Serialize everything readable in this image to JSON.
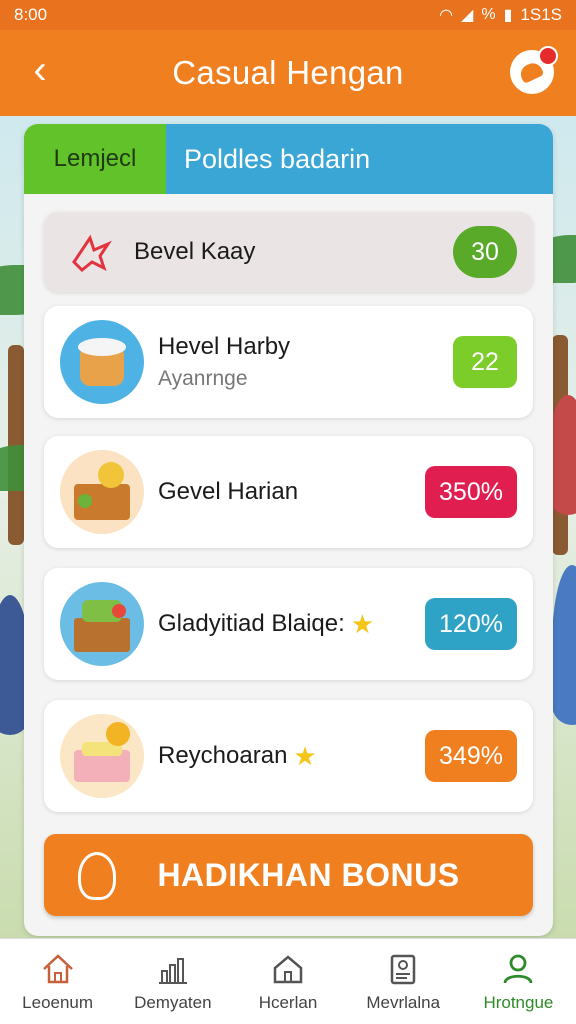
{
  "status_bar": {
    "time": "8:00",
    "battery_text": "1S1S",
    "percent_text": "%"
  },
  "app_bar": {
    "back_label": "‹",
    "title": "Casual Hengan"
  },
  "tabs": [
    {
      "label": "Lemjecl"
    },
    {
      "label": "Poldles badarin"
    }
  ],
  "rows": [
    {
      "name": "Bevel Kaay",
      "sub": "",
      "badge": "30",
      "badge_color": "#5aaa2a",
      "icon": "plane-icon"
    },
    {
      "name": "Hevel Harby",
      "sub": "Ayanrnge",
      "badge": "22",
      "badge_color": "#7ccc2a",
      "icon": "bucket-icon"
    },
    {
      "name": "Gevel Harian",
      "sub": "",
      "badge": "350%",
      "badge_color": "#e01f50",
      "icon": "treasure-chest-icon"
    },
    {
      "name": "Gladyitiad Blaiqe:",
      "sub": "",
      "badge": "120%",
      "badge_color": "#2fa3c6",
      "icon": "gift-crate-icon"
    },
    {
      "name": "Reychoaran",
      "sub": "",
      "badge": "349%",
      "badge_color": "#f07f1f",
      "icon": "coin-box-icon"
    }
  ],
  "bonus_button": {
    "label": "HADIKHAN BONUS"
  },
  "bottom_nav": [
    {
      "label": "Leoenum",
      "icon": "home-icon"
    },
    {
      "label": "Demyaten",
      "icon": "chart-icon"
    },
    {
      "label": "Hcerlan",
      "icon": "house-icon"
    },
    {
      "label": "Mevrlalna",
      "icon": "document-icon"
    },
    {
      "label": "Hrotngue",
      "icon": "profile-icon",
      "active": true
    }
  ],
  "colors": {
    "accent": "#f07f1f",
    "green": "#62c22a",
    "blue": "#3aa6d6",
    "active_nav": "#2e8b2a"
  }
}
